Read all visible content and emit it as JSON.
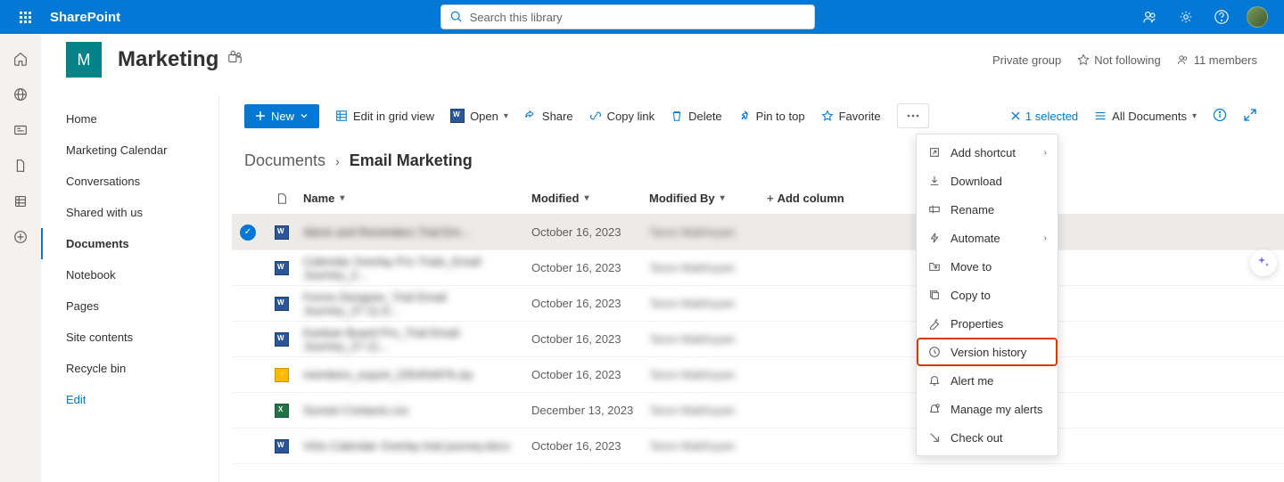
{
  "header": {
    "brand": "SharePoint",
    "search_placeholder": "Search this library"
  },
  "site": {
    "logo_letter": "M",
    "title": "Marketing",
    "privacy": "Private group",
    "follow_label": "Not following",
    "members_label": "11 members"
  },
  "nav": {
    "items": [
      {
        "label": "Home"
      },
      {
        "label": "Marketing Calendar"
      },
      {
        "label": "Conversations"
      },
      {
        "label": "Shared with us"
      },
      {
        "label": "Documents",
        "active": true
      },
      {
        "label": "Notebook"
      },
      {
        "label": "Pages"
      },
      {
        "label": "Site contents"
      },
      {
        "label": "Recycle bin"
      }
    ],
    "edit_label": "Edit"
  },
  "toolbar": {
    "new_label": "New",
    "edit_grid_label": "Edit in grid view",
    "open_label": "Open",
    "share_label": "Share",
    "copy_link_label": "Copy link",
    "delete_label": "Delete",
    "pin_label": "Pin to top",
    "favorite_label": "Favorite",
    "selected_label": "1 selected",
    "view_label": "All Documents"
  },
  "breadcrumb": {
    "root": "Documents",
    "current": "Email Marketing"
  },
  "columns": {
    "name": "Name",
    "modified": "Modified",
    "modified_by": "Modified By",
    "add": "Add column"
  },
  "rows": [
    {
      "name": "Alerts and Reminders Trial Em...",
      "type": "word",
      "modified": "October 16, 2023",
      "modified_by": "Taron Makhoyan",
      "selected": true
    },
    {
      "name": "Calendar Overlay Pro Trials_Email Journey_2...",
      "type": "word",
      "modified": "October 16, 2023",
      "modified_by": "Taron Makhoyan"
    },
    {
      "name": "Forms Designer_Trial Email Journey_27.11.d...",
      "type": "word",
      "modified": "October 16, 2023",
      "modified_by": "Taron Makhoyan"
    },
    {
      "name": "Kanban Board Pro_Trial Email Journey_27.11...",
      "type": "word",
      "modified": "October 16, 2023",
      "modified_by": "Taron Makhoyan"
    },
    {
      "name": "members_export_235454978.zip",
      "type": "zip",
      "modified": "October 16, 2023",
      "modified_by": "Taron Makhoyan"
    },
    {
      "name": "Sunset Contacts.csv",
      "type": "excel",
      "modified": "December 13, 2023",
      "modified_by": "Taron Makhoyan"
    },
    {
      "name": "Virto Calendar Overlay trial journey.docx",
      "type": "word",
      "modified": "October 16, 2023",
      "modified_by": "Taron Makhoyan"
    }
  ],
  "context_menu": {
    "items": [
      {
        "label": "Add shortcut",
        "icon": "shortcut",
        "submenu": true
      },
      {
        "label": "Download",
        "icon": "download"
      },
      {
        "label": "Rename",
        "icon": "rename"
      },
      {
        "label": "Automate",
        "icon": "automate",
        "submenu": true
      },
      {
        "label": "Move to",
        "icon": "move"
      },
      {
        "label": "Copy to",
        "icon": "copy"
      },
      {
        "label": "Properties",
        "icon": "properties"
      },
      {
        "label": "Version history",
        "icon": "history",
        "highlighted": true
      },
      {
        "label": "Alert me",
        "icon": "alert"
      },
      {
        "label": "Manage my alerts",
        "icon": "manage-alerts"
      },
      {
        "label": "Check out",
        "icon": "checkout"
      }
    ]
  }
}
